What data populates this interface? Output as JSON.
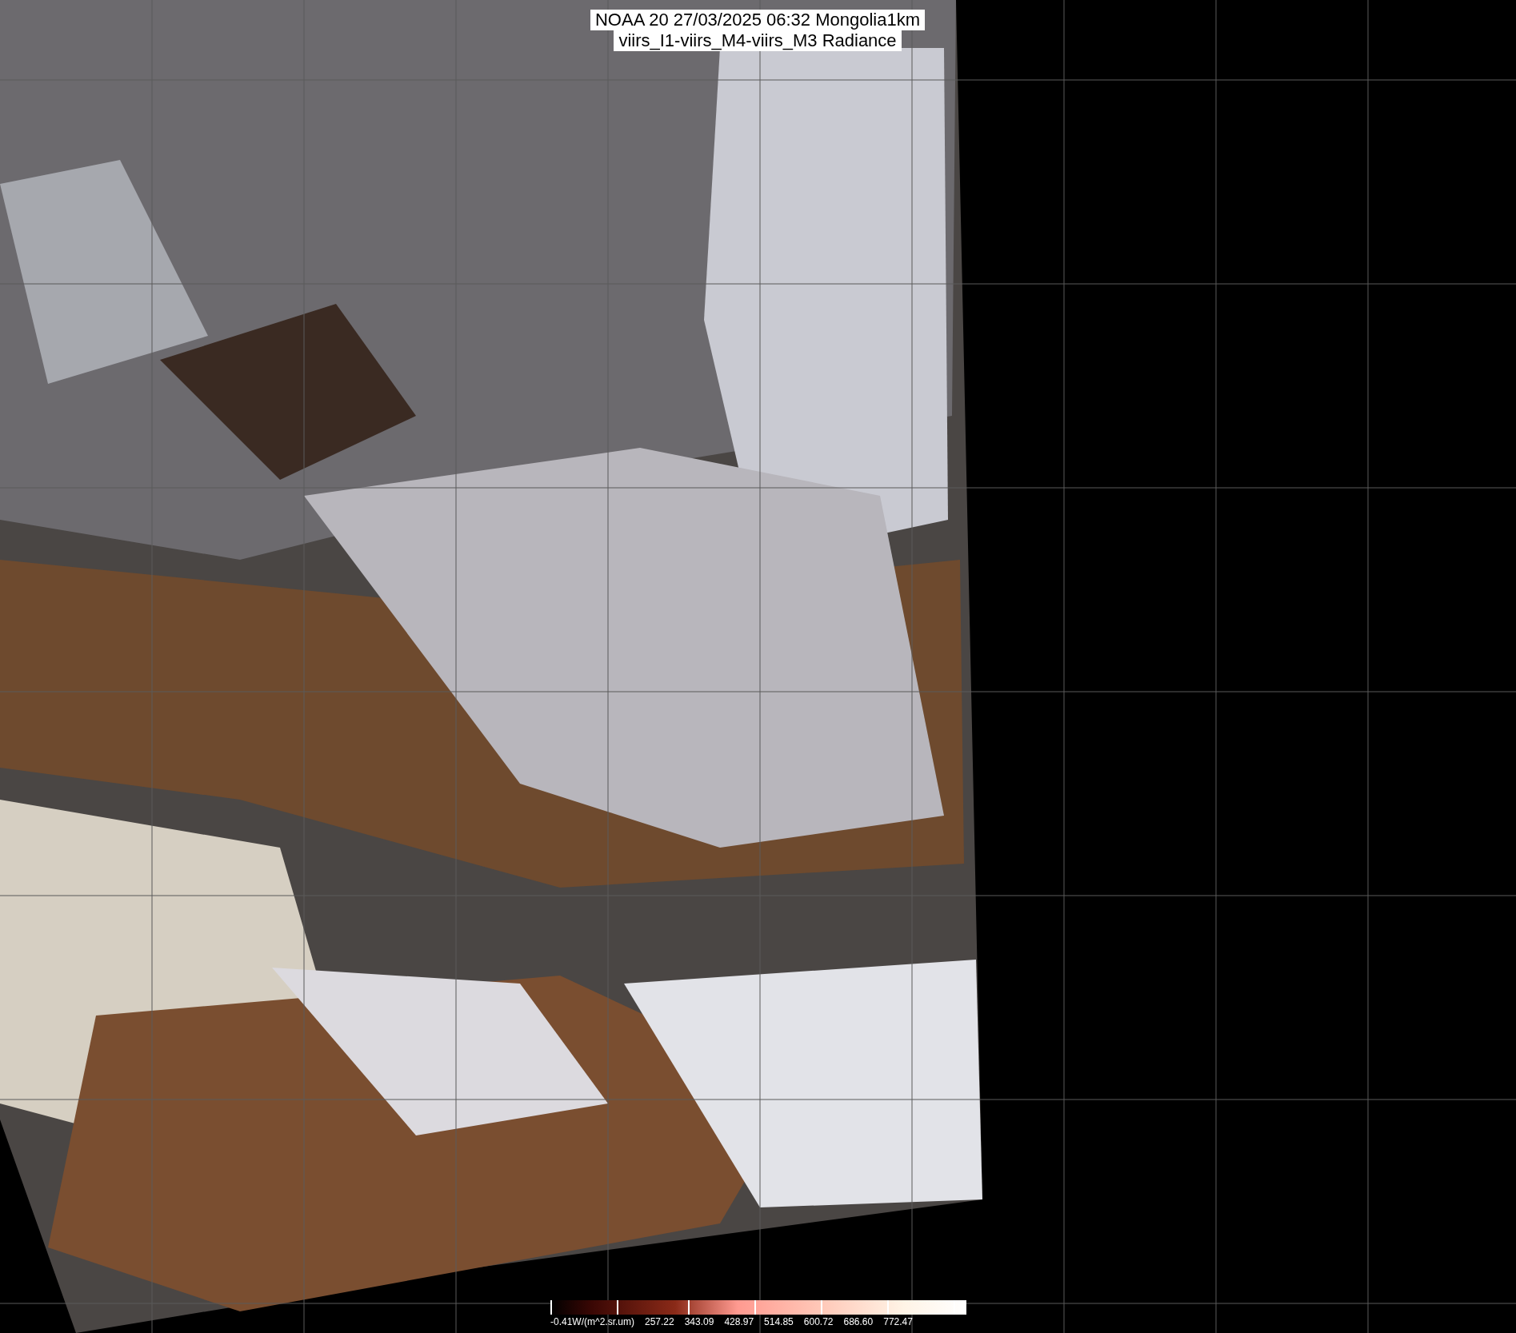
{
  "title": {
    "lines": [
      "NOAA 20 27/03/2025 06:32 Mongolia1km",
      "viirs_I1-viirs_M4-viirs_M3 Radiance"
    ]
  },
  "colorbar": {
    "labels": [
      "-0.41W/(m^2.sr.um)",
      "257.22",
      "343.09",
      "428.97",
      "514.85",
      "600.72",
      "686.60",
      "772.47"
    ]
  }
}
